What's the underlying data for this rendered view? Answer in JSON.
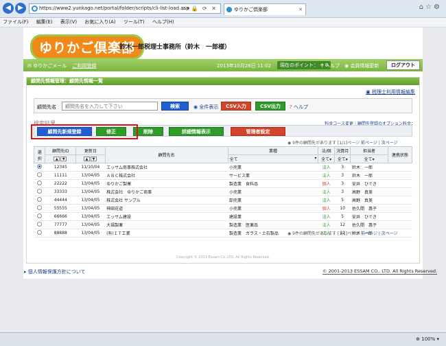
{
  "browser": {
    "url": "https://www2.yunkago.net/portal/folder/scripts/cli-list-load.asp",
    "tab_title": "ゆりかご倶楽部",
    "menu": [
      "ファイル(F)",
      "編集(E)",
      "表示(V)",
      "お気に入り(A)",
      "ツール(T)",
      "ヘルプ(H)"
    ],
    "zoom": "100%"
  },
  "header": {
    "logo": "ゆりかご倶楽部",
    "office": "鈴木一郎税理士事務所（鈴木　一郎様）"
  },
  "topband": {
    "mail": "ゆりかごメール",
    "register": "ご利用登録",
    "datetime": "2013年10月28日 11:02",
    "points_label": "現在のポイント：",
    "points_value": "0",
    "help": "ヘルプ",
    "member_update": "会員情報更新",
    "logout": "ログアウト"
  },
  "panel": {
    "title": "顧問先情報管理：顧問先情報一覧",
    "tax_link": "税理士利用情報編集",
    "search_label": "顧問先名",
    "search_placeholder": "顧問先名を入力して下さい",
    "search_btn": "検索",
    "show_all": "全件表示",
    "csv_in": "CSV入力",
    "csv_out": "CSV出力",
    "help": "ヘルプ",
    "result_label": "検索結果",
    "options": "料金コース変更｜顧問先登録のオプション料金：",
    "actions": {
      "new": "顧問先新規登録",
      "edit": "修正",
      "delete": "削除",
      "detail": "詳細情報表示",
      "admin": "管理者設定"
    },
    "pager_text": "9件の顧問先があります [1/1]ページ",
    "pager_prev": "前ページ",
    "pager_next": "次ページ",
    "copyright_inner": "Copyright © 2013 Essam Co.,LTD. All Rights Reserved."
  },
  "table": {
    "headers": {
      "select": "選択",
      "client_id": "顧問先ID",
      "updated": "更新日",
      "name": "顧問先名",
      "industry": "業種",
      "entity": "法/個",
      "fiscal": "決算月",
      "staff": "担当者",
      "status": "連携状態"
    },
    "filters": {
      "industry": "全て",
      "entity": "全て",
      "fiscal": "全て",
      "staff": "全て"
    },
    "rows": [
      {
        "id": "12345",
        "date": "11/10/04",
        "name": "エッサム商事株式会社",
        "industry": "小売業",
        "entity": "法人",
        "month": "3",
        "staff": "鈴木　一郎",
        "selected": true
      },
      {
        "id": "11111",
        "date": "13/04/05",
        "name": "ＡＢＣ株式会社",
        "industry": "サービス業",
        "entity": "法人",
        "month": "3",
        "staff": "鈴木　一郎",
        "selected": false
      },
      {
        "id": "22222",
        "date": "13/04/05",
        "name": "ゆりかご製菓",
        "industry": "製造業　食料品",
        "entity": "個人",
        "month": "3",
        "staff": "安井　ひでき",
        "selected": false
      },
      {
        "id": "33333",
        "date": "13/04/05",
        "name": "株式会社　ゆりかご商事",
        "industry": "小売業",
        "entity": "法人",
        "month": "3",
        "staff": "高野　真美",
        "selected": false
      },
      {
        "id": "44444",
        "date": "13/04/05",
        "name": "株式会社 サンプル",
        "industry": "卸売業",
        "entity": "法人",
        "month": "5",
        "staff": "高野　真美",
        "selected": false
      },
      {
        "id": "55555",
        "date": "13/04/05",
        "name": "神田花道",
        "industry": "小売業",
        "entity": "個人",
        "month": "10",
        "staff": "佐久間　惠子",
        "selected": false
      },
      {
        "id": "66666",
        "date": "13/04/05",
        "name": "エッサム建設",
        "industry": "建設業",
        "entity": "法人",
        "month": "5",
        "staff": "安井　ひでき",
        "selected": false
      },
      {
        "id": "77777",
        "date": "13/04/05",
        "name": "大福製薬",
        "industry": "製造業　医薬品",
        "entity": "法人",
        "month": "12",
        "staff": "佐久間　惠子",
        "selected": false
      },
      {
        "id": "88888",
        "date": "13/04/05",
        "name": "(有)ＩＴ工業",
        "industry": "製造業　ガラス・土石製品",
        "entity": "法人",
        "month": "12",
        "staff": "鈴木　一郎",
        "selected": false
      }
    ]
  },
  "footer": {
    "privacy": "個人情報保護方針について",
    "copyright": "© 2001-2013 ESSAM CO., LTD. All Rights Reserved."
  },
  "colors": {
    "accent_green": "#7bb43e",
    "logo_orange": "#ef8a1a",
    "highlight_red": "#e1111c"
  }
}
